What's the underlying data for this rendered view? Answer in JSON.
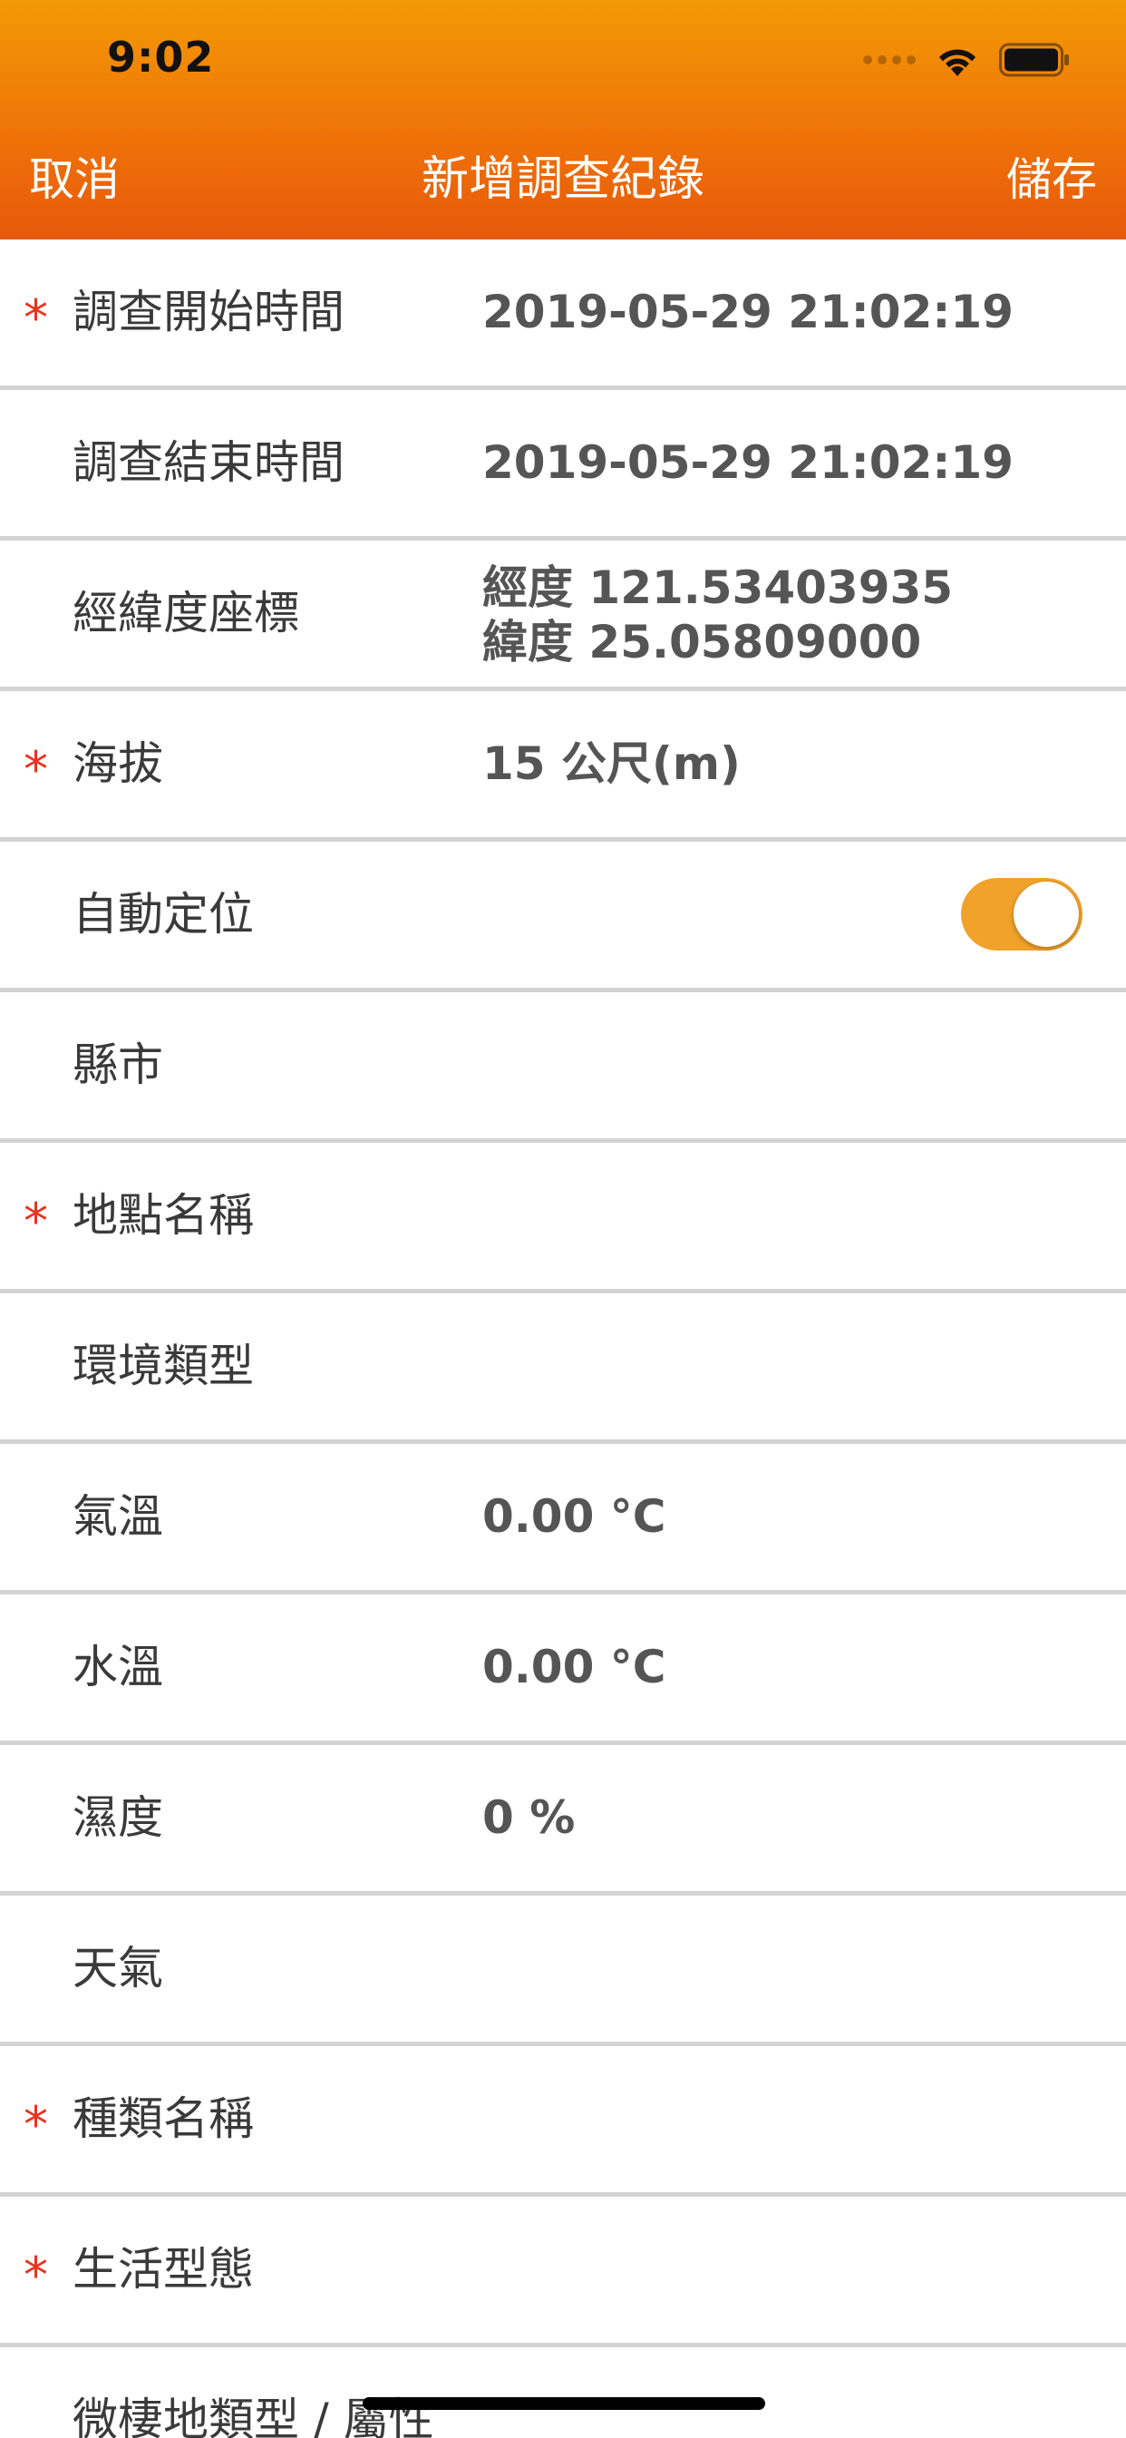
{
  "status_bar": {
    "time": "9:02"
  },
  "nav": {
    "cancel": "取消",
    "title": "新增調查紀錄",
    "save": "儲存"
  },
  "form": {
    "required_mark": "*",
    "start_time": {
      "label": "調查開始時間",
      "value": "2019-05-29 21:02:19",
      "required": true
    },
    "end_time": {
      "label": "調查結束時間",
      "value": "2019-05-29 21:02:19",
      "required": false
    },
    "coords": {
      "label": "經緯度座標",
      "longitude": "經度 121.53403935",
      "latitude": "緯度 25.05809000",
      "required": false
    },
    "altitude": {
      "label": "海拔",
      "value": "15 公尺(m)",
      "required": true
    },
    "auto_locate": {
      "label": "自動定位",
      "enabled": true,
      "toggle_color": "#f1a22b"
    },
    "county": {
      "label": "縣市",
      "value": ""
    },
    "place_name": {
      "label": "地點名稱",
      "value": "",
      "required": true
    },
    "environment": {
      "label": "環境類型",
      "value": ""
    },
    "air_temp": {
      "label": "氣溫",
      "value": "0.00 °C"
    },
    "water_temp": {
      "label": "水溫",
      "value": "0.00 °C"
    },
    "humidity": {
      "label": "濕度",
      "value": "0 %"
    },
    "weather": {
      "label": "天氣",
      "value": ""
    },
    "species": {
      "label": "種類名稱",
      "value": "",
      "required": true
    },
    "life_form": {
      "label": "生活型態",
      "value": "",
      "required": true
    },
    "microhabitat": {
      "label": "微棲地類型 / 屬性",
      "value": ""
    }
  },
  "colors": {
    "header_top": "#f39a05",
    "header_bottom": "#e8580c",
    "required": "#e8331f",
    "divider": "#d3d3d3"
  }
}
